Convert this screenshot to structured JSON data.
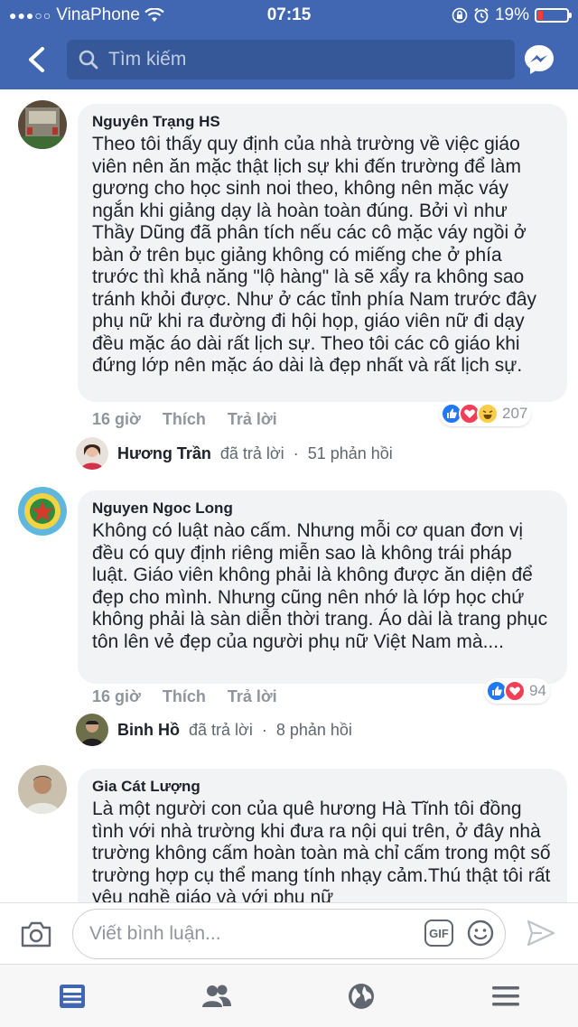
{
  "status_bar": {
    "carrier": "VinaPhone",
    "time": "07:15",
    "battery_percent": "19%",
    "battery_level": 0.19,
    "battery_color": "#ff3b30"
  },
  "header": {
    "search_placeholder": "Tìm kiếm",
    "brand_color": "#4267b2",
    "icons": [
      "back-arrow-icon",
      "search-icon",
      "messenger-icon"
    ]
  },
  "comments": [
    {
      "author": "Nguyên Trạng HS",
      "text": "Theo tôi thấy quy định của  nhà trường về việc giáo viên nên ăn mặc thật lịch sự khi đến trường để làm gương cho học sinh noi theo, không nên mặc váy  ngắn khi giảng dạy là hoàn toàn đúng. Bởi vì như Thầy Dũng đã phân tích nếu các cô mặc váy ngồi ở bàn ở trên bục giảng không có miếng che ở phía trước thì khả năng \"lộ hàng\" là sẽ xẩy ra không sao tránh khỏi được. Như ở các tỉnh phía Nam trước đây phụ nữ khi ra đường đi hội họp, giáo viên nữ đi dạy đều mặc áo dài rất lịch sự. Theo tôi các cô giáo  khi đứng lớp nên mặc áo dài là đẹp nhất và rất lịch sự.",
      "time": "16 giờ",
      "like_label": "Thích",
      "reply_label": "Trả lời",
      "reaction_count": "207",
      "reactions": [
        "like",
        "love",
        "haha"
      ],
      "reply_summary": {
        "name": "Hương Trần",
        "action": "đã trả lời",
        "sep": "·",
        "count": "51 phản hồi"
      }
    },
    {
      "author": "Nguyen Ngoc Long",
      "text": "Không có luật nào cấm.  Nhưng mỗi cơ quan đơn vị đều có quy định riêng miễn sao là không trái pháp luật.  Giáo viên không phải là không được ăn diện để đẹp cho mình.  Nhưng cũng nên nhớ là lớp học chứ không phải là sàn diễn thời trang.  Áo dài là trang phục tôn lên vẻ đẹp của người phụ nữ Việt Nam mà....",
      "time": "16 giờ",
      "like_label": "Thích",
      "reply_label": "Trả lời",
      "reaction_count": "94",
      "reactions": [
        "like",
        "love"
      ],
      "reply_summary": {
        "name": "Binh Hồ",
        "action": "đã trả lời",
        "sep": "·",
        "count": "8 phản hồi"
      }
    },
    {
      "author": "Gia Cát Lượng",
      "text": "Là một người con của quê hương Hà Tĩnh tôi đồng tình với nhà trường khi đưa ra nội qui trên, ở đây nhà trường không cấm hoàn toàn mà chỉ cấm trong một số trường hợp cụ thể mang tính nhạy cảm.Thú thật tôi rất yêu nghề giáo và với phụ nữ"
    }
  ],
  "composer": {
    "placeholder": "Viết bình luận...",
    "gif_label": "GIF",
    "icons": [
      "camera-icon",
      "gif-icon",
      "emoji-icon",
      "send-icon"
    ]
  },
  "bottom_nav": {
    "items": [
      "feed-icon",
      "friends-icon",
      "globe-icon",
      "menu-icon"
    ],
    "active": "feed-icon"
  },
  "colors": {
    "like": "#2078f4",
    "love": "#f33e58",
    "haha": "#fbcd4b",
    "bubble": "#f2f3f5"
  }
}
